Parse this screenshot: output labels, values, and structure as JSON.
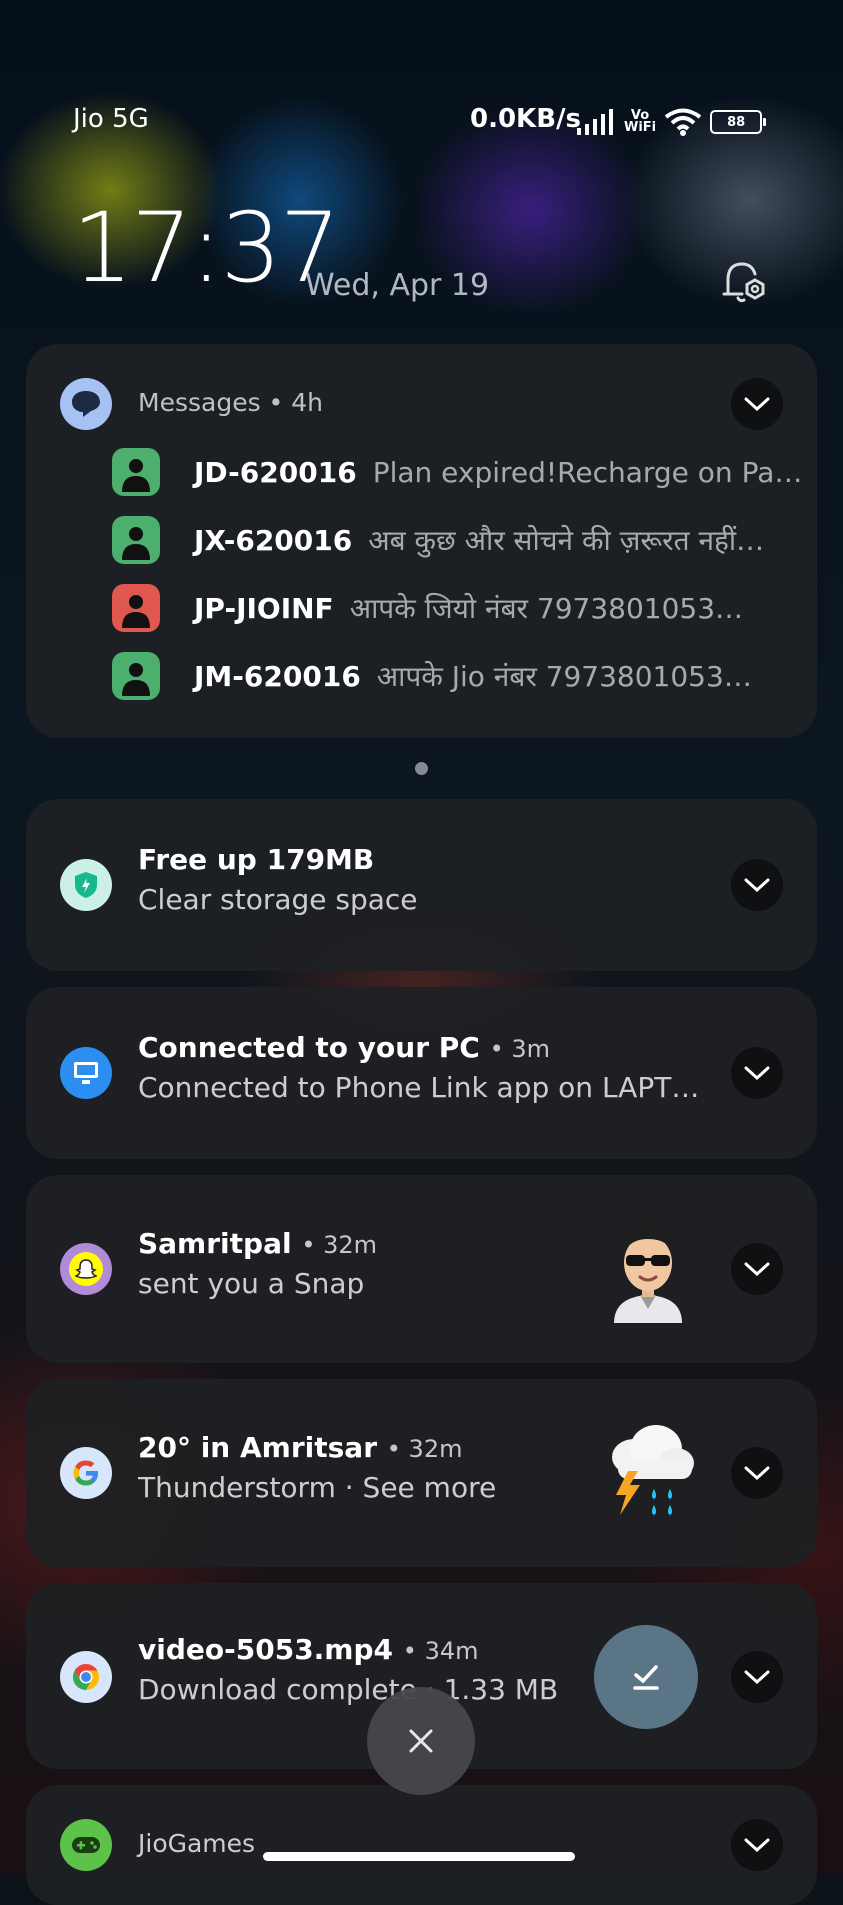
{
  "status_bar": {
    "carrier": "Jio 5G",
    "speed": "0.0KB/s",
    "vowifi_top": "Vo",
    "vowifi_bottom": "WiFi",
    "battery": "88",
    "signal_icon": "signal-icon",
    "wifi_icon": "wifi-icon"
  },
  "header": {
    "time": "17:37",
    "date": "Wed, Apr 19",
    "settings_icon": "notification-settings-icon"
  },
  "messages": {
    "app": "Messages",
    "time": "4h",
    "rows": [
      {
        "sender": "JD-620016",
        "preview": "Plan expired!Recharge on Pa…",
        "color": "#4caf6e"
      },
      {
        "sender": "JX-620016",
        "preview": "अब कुछ और सोचने की ज़रूरत नहीं…",
        "color": "#4caf6e"
      },
      {
        "sender": "JP-JIOINF",
        "preview": "आपके जियो नंबर 7973801053…",
        "color": "#e0574f"
      },
      {
        "sender": "JM-620016",
        "preview": "आपके Jio नंबर 7973801053…",
        "color": "#4caf6e"
      }
    ]
  },
  "notifications": [
    {
      "title": "Free up 179MB",
      "time": "",
      "subtitle": "Clear storage space",
      "icon": "security-shield-icon"
    },
    {
      "title": "Connected to your PC",
      "time": "3m",
      "subtitle": "Connected to Phone Link app on LAPT…",
      "icon": "phone-link-icon"
    },
    {
      "title": "Samritpal",
      "time": "32m",
      "subtitle": "sent you a Snap",
      "icon": "snapchat-icon",
      "thumbnail": "bitmoji-avatar"
    },
    {
      "title": "20° in Amritsar",
      "time": "32m",
      "subtitle": "Thunderstorm · See more",
      "icon": "google-icon",
      "thumbnail": "thunderstorm-icon"
    },
    {
      "title": "video-5053.mp4",
      "time": "34m",
      "subtitle": "Download complete · 1.33 MB",
      "icon": "chrome-icon",
      "action": "open-download-button"
    },
    {
      "title": "JioGames",
      "time": "",
      "subtitle": "",
      "icon": "gamepad-icon"
    }
  ],
  "dismiss_all_icon": "close-icon"
}
